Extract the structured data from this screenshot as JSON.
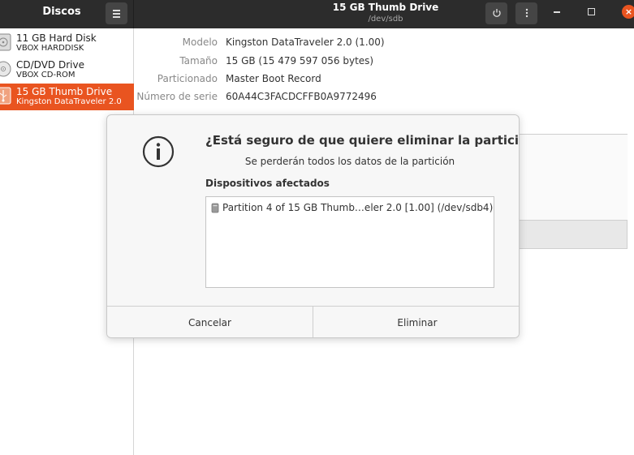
{
  "titlebar": {
    "app_title": "Discos",
    "title": "15 GB Thumb Drive",
    "subtitle": "/dev/sdb",
    "close_color": "#e95420"
  },
  "sidebar": {
    "drives": [
      {
        "name": "11 GB Hard Disk",
        "sub": "VBOX HARDDISK",
        "icon": "hard-disk-icon",
        "selected": false
      },
      {
        "name": "CD/DVD Drive",
        "sub": "VBOX CD-ROM",
        "icon": "optical-disc-icon",
        "selected": false
      },
      {
        "name": "15 GB Thumb Drive",
        "sub": "Kingston DataTraveler 2.0",
        "icon": "usb-drive-icon",
        "selected": true
      }
    ],
    "selected_color": "#e95420"
  },
  "details": [
    {
      "label": "Modelo",
      "value": "Kingston DataTraveler 2.0 (1.00)"
    },
    {
      "label": "Tamaño",
      "value": "15 GB (15 479 597 056 bytes)"
    },
    {
      "label": "Particionado",
      "value": "Master Boot Record"
    },
    {
      "label": "Número de serie",
      "value": "60A44C3FACDCFFB0A9772496"
    }
  ],
  "dialog": {
    "title": "¿Está seguro de que quiere eliminar la partición?",
    "subtitle": "Se perderán todos los datos de la partición",
    "section_label": "Dispositivos afectados",
    "affected": [
      "Partition 4 of 15 GB Thumb…eler 2.0 [1.00] (/dev/sdb4)"
    ],
    "cancel_label": "Cancelar",
    "delete_label": "Eliminar",
    "icon": "info-icon"
  }
}
